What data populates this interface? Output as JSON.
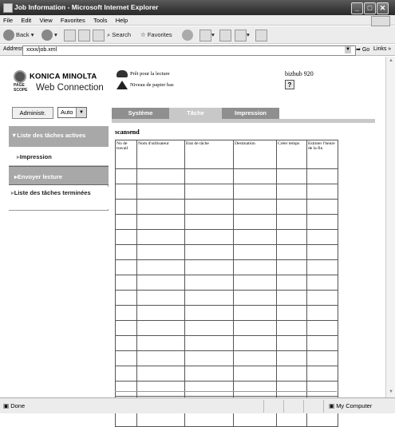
{
  "window": {
    "title": "Job Information - Microsoft Internet Explorer"
  },
  "menu": [
    "File",
    "Edit",
    "View",
    "Favorites",
    "Tools",
    "Help"
  ],
  "toolbar": {
    "back_label": "Back",
    "search_label": "Search",
    "favorites_label": "Favorites"
  },
  "address": {
    "label": "Address",
    "value": "xxxx/job.xml",
    "go_label": "Go",
    "links_label": "Links"
  },
  "header": {
    "brand": "KONICA MINOLTA",
    "pagescope_line1": "PAGE",
    "pagescope_line2": "SCOPE",
    "product": "Web Connection",
    "status_ready": "Prêt pour la lecture",
    "status_paper": "Niveau de papier bas",
    "model": "bizhub 920",
    "help_glyph": "?"
  },
  "controls": {
    "admin_button": "Administr.",
    "mode_select": "Auto"
  },
  "tabs": [
    {
      "label": "Système",
      "color": "#8f8f8f"
    },
    {
      "label": "Tâche",
      "color": "#c8c8c8"
    },
    {
      "label": "Impression",
      "color": "#8f8f8f"
    }
  ],
  "sidebar": {
    "items": [
      {
        "label": "▼Liste des tâches actives",
        "style": "header"
      },
      {
        "label": "Impression",
        "style": "sub"
      },
      {
        "label": "Envoyer lecture",
        "style": "active"
      },
      {
        "label": "Liste des tâches terminées",
        "style": "top"
      }
    ]
  },
  "main": {
    "heading": "scansend",
    "columns": [
      "No de travail",
      "Nom d'utilisateur",
      "Etat de tâche",
      "Destination",
      "Créer temps",
      "Estimer l'heure de la fin"
    ],
    "empty_rows": 17
  },
  "statusbar": {
    "left": "Done",
    "zone": "My Computer"
  }
}
